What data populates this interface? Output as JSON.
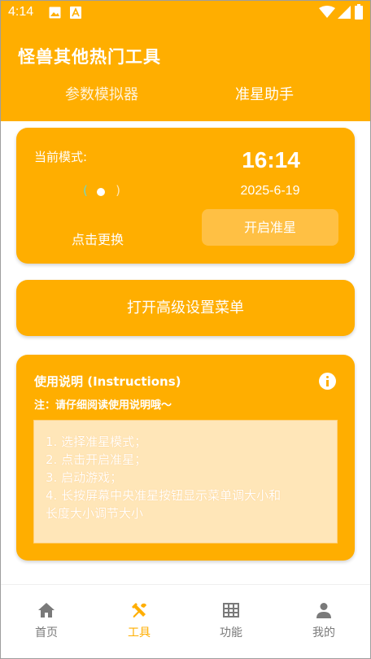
{
  "status_bar": {
    "time": "4:14",
    "icons": [
      "image-icon",
      "a-box-icon",
      "wifi-icon",
      "cell-signal-icon",
      "battery-icon"
    ]
  },
  "app_bar": {
    "title": "怪兽其他热门工具",
    "tabs": [
      {
        "label": "参数模拟器",
        "selected": false
      },
      {
        "label": "准星助手",
        "selected": true
      }
    ]
  },
  "mode_card": {
    "mode_label": "当前模式:",
    "time": "16:14",
    "date": "2025-6-19",
    "change_label": "点击更换",
    "start_button": "开启准星"
  },
  "advanced_card": {
    "label": "打开高级设置菜单"
  },
  "help_card": {
    "title": "使用说明 (Instructions)",
    "note": "注：请仔细阅读使用说明哦～",
    "steps": [
      "1. 选择准星模式；",
      "2. 点击开启准星；",
      "3. 启动游戏；",
      "4. 长按屏幕中央准星按钮显示菜单调大小和",
      "长度大小调节大小"
    ]
  },
  "bottom_nav": {
    "items": [
      {
        "label": "首页",
        "icon": "home-icon",
        "active": false
      },
      {
        "label": "工具",
        "icon": "tools-icon",
        "active": true
      },
      {
        "label": "功能",
        "icon": "grid-icon",
        "active": false
      },
      {
        "label": "我的",
        "icon": "person-icon",
        "active": false
      }
    ]
  },
  "colors": {
    "accent": "#ffae00",
    "button_light": "#ffc044",
    "help_box": "#ffe6b8",
    "nav_inactive": "#7a7a7a"
  }
}
